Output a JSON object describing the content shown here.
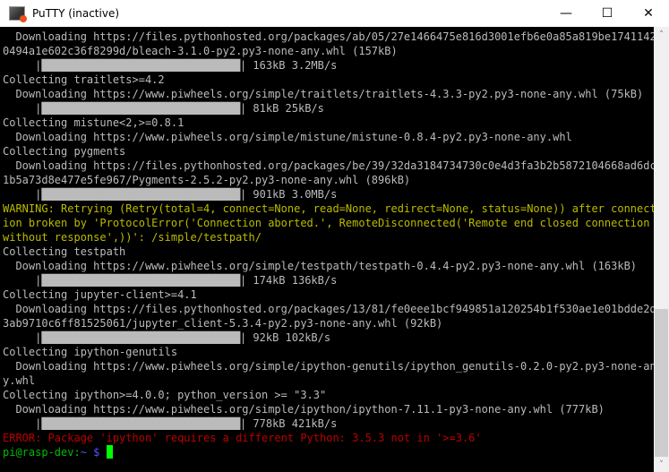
{
  "window": {
    "title": "PuTTY (inactive)",
    "minimize_glyph": "—",
    "maximize_glyph": "☐",
    "close_glyph": "✕"
  },
  "colors": {
    "default": "#bbbbbb",
    "warning": "#bbbb00",
    "error": "#bb0000",
    "prompt_user": "#00bb00",
    "prompt_path": "#5555ff",
    "cursor": "#00ff00",
    "background": "#000000"
  },
  "scrollbar": {
    "up_glyph": "˄",
    "down_glyph": "˅"
  },
  "terminal": {
    "lines": [
      [
        {
          "t": "  Downloading https://files.pythonhosted.org/packages/ab/05/27e1466475e816d3001efb6e0a85a819be1741142",
          "c": "default"
        }
      ],
      [
        {
          "t": "0494a1e602c36f8299d/bleach-3.1.0-py2.py3-none-any.whl (157kB)",
          "c": "default"
        }
      ],
      [
        {
          "t": "     |",
          "c": "default"
        },
        {
          "t": "████████████████████████████████",
          "c": "bar"
        },
        {
          "t": "| 163kB 3.2MB/s",
          "c": "default"
        }
      ],
      [
        {
          "t": "Collecting traitlets>=4.2",
          "c": "default"
        }
      ],
      [
        {
          "t": "  Downloading https://www.piwheels.org/simple/traitlets/traitlets-4.3.3-py2.py3-none-any.whl (75kB)",
          "c": "default"
        }
      ],
      [
        {
          "t": "     |",
          "c": "default"
        },
        {
          "t": "████████████████████████████████",
          "c": "bar"
        },
        {
          "t": "| 81kB 25kB/s",
          "c": "default"
        }
      ],
      [
        {
          "t": "Collecting mistune<2,>=0.8.1",
          "c": "default"
        }
      ],
      [
        {
          "t": "  Downloading https://www.piwheels.org/simple/mistune/mistune-0.8.4-py2.py3-none-any.whl",
          "c": "default"
        }
      ],
      [
        {
          "t": "Collecting pygments",
          "c": "default"
        }
      ],
      [
        {
          "t": "  Downloading https://files.pythonhosted.org/packages/be/39/32da3184734730c0e4d3fa3b2b5872104668ad6dc",
          "c": "default"
        }
      ],
      [
        {
          "t": "1b5a73d8e477e5fe967/Pygments-2.5.2-py2.py3-none-any.whl (896kB)",
          "c": "default"
        }
      ],
      [
        {
          "t": "     |",
          "c": "default"
        },
        {
          "t": "████████████████████████████████",
          "c": "bar"
        },
        {
          "t": "| 901kB 3.0MB/s",
          "c": "default"
        }
      ],
      [
        {
          "t": "WARNING: Retrying (Retry(total=4, connect=None, read=None, redirect=None, status=None)) after connect",
          "c": "warning"
        }
      ],
      [
        {
          "t": "ion broken by 'ProtocolError('Connection aborted.', RemoteDisconnected('Remote end closed connection",
          "c": "warning"
        }
      ],
      [
        {
          "t": "without response',))': /simple/testpath/",
          "c": "warning"
        }
      ],
      [
        {
          "t": "Collecting testpath",
          "c": "default"
        }
      ],
      [
        {
          "t": "  Downloading https://www.piwheels.org/simple/testpath/testpath-0.4.4-py2.py3-none-any.whl (163kB)",
          "c": "default"
        }
      ],
      [
        {
          "t": "     |",
          "c": "default"
        },
        {
          "t": "████████████████████████████████",
          "c": "bar"
        },
        {
          "t": "| 174kB 136kB/s",
          "c": "default"
        }
      ],
      [
        {
          "t": "Collecting jupyter-client>=4.1",
          "c": "default"
        }
      ],
      [
        {
          "t": "  Downloading https://files.pythonhosted.org/packages/13/81/fe0eee1bcf949851a120254b1f530ae1e01bdde2d",
          "c": "default"
        }
      ],
      [
        {
          "t": "3ab9710c6ff81525061/jupyter_client-5.3.4-py2.py3-none-any.whl (92kB)",
          "c": "default"
        }
      ],
      [
        {
          "t": "     |",
          "c": "default"
        },
        {
          "t": "████████████████████████████████",
          "c": "bar"
        },
        {
          "t": "| 92kB 102kB/s",
          "c": "default"
        }
      ],
      [
        {
          "t": "Collecting ipython-genutils",
          "c": "default"
        }
      ],
      [
        {
          "t": "  Downloading https://www.piwheels.org/simple/ipython-genutils/ipython_genutils-0.2.0-py2.py3-none-an",
          "c": "default"
        }
      ],
      [
        {
          "t": "y.whl",
          "c": "default"
        }
      ],
      [
        {
          "t": "Collecting ipython>=4.0.0; python_version >= \"3.3\"",
          "c": "default"
        }
      ],
      [
        {
          "t": "  Downloading https://www.piwheels.org/simple/ipython/ipython-7.11.1-py3-none-any.whl (777kB)",
          "c": "default"
        }
      ],
      [
        {
          "t": "     |",
          "c": "default"
        },
        {
          "t": "████████████████████████████████",
          "c": "bar"
        },
        {
          "t": "| 778kB 421kB/s",
          "c": "default"
        }
      ],
      [
        {
          "t": "ERROR: Package 'ipython' requires a different Python: 3.5.3 not in '>=3.6'",
          "c": "error"
        }
      ],
      [
        {
          "t": "pi@rasp-dev:",
          "c": "prompt_user"
        },
        {
          "t": "~ $ ",
          "c": "prompt_path"
        }
      ]
    ]
  }
}
